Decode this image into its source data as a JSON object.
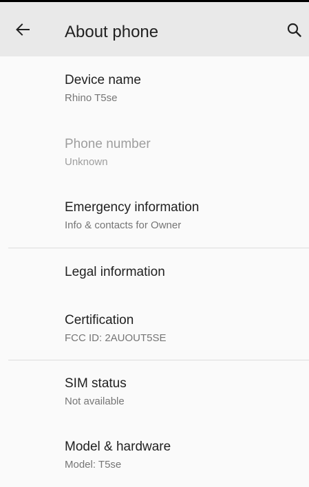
{
  "app_bar": {
    "title": "About phone",
    "back_icon": "arrow-back-icon",
    "search_icon": "search-icon"
  },
  "items": [
    {
      "title": "Device name",
      "summary": "Rhino T5se",
      "enabled": true
    },
    {
      "title": "Phone number",
      "summary": "Unknown",
      "enabled": false
    },
    {
      "title": "Emergency information",
      "summary": "Info & contacts for Owner",
      "enabled": true
    },
    {
      "title": "Legal information",
      "summary": "",
      "enabled": true
    },
    {
      "title": "Certification",
      "summary": "FCC ID: 2AUOUT5SE",
      "enabled": true
    },
    {
      "title": "SIM status",
      "summary": "Not available",
      "enabled": true
    },
    {
      "title": "Model & hardware",
      "summary": "Model: T5se",
      "enabled": true
    }
  ],
  "colors": {
    "app_bar_bg": "#e9e9e9",
    "background": "#fafafa",
    "primary_text": "#212121",
    "secondary_text": "#757575",
    "disabled_text": "#9e9e9e",
    "divider": "#dcdcdc"
  }
}
